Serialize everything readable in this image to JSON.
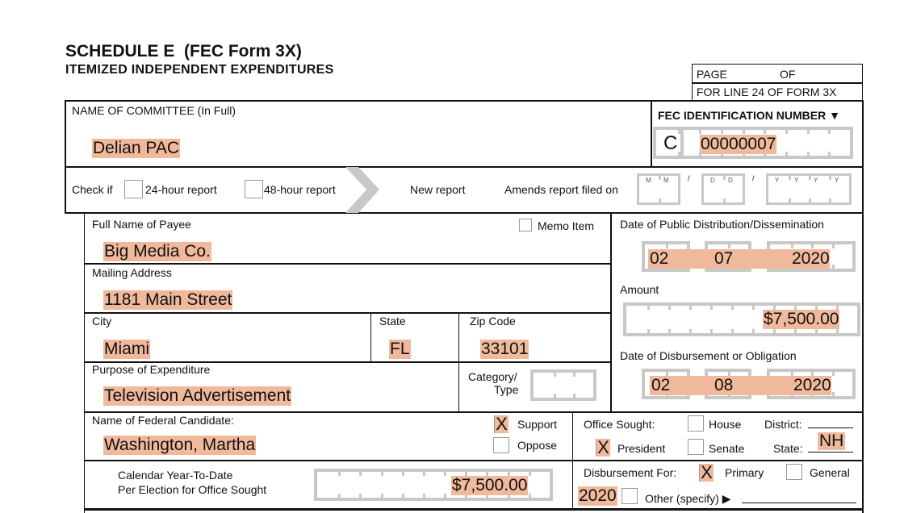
{
  "header": {
    "title": "SCHEDULE E  (FEC Form 3X)",
    "subtitle": "ITEMIZED INDEPENDENT EXPENDITURES",
    "page_label": "PAGE",
    "of_label": "OF",
    "line_ref": "FOR LINE 24 OF FORM 3X"
  },
  "committee": {
    "name_label": "NAME OF COMMITTEE (In Full)",
    "name_value": "Delian PAC",
    "fec_id_label": "FEC IDENTIFICATION NUMBER ▼",
    "fec_id_prefix": "C",
    "fec_id_value": "00000007"
  },
  "report_type": {
    "check_if_label": "Check if",
    "option_24h": "24-hour report",
    "option_48h": "48-hour report",
    "new_report": "New report",
    "amends_label": "Amends report filed on",
    "date_placeholders": {
      "m": "M",
      "d": "D",
      "y": "Y"
    },
    "sep": "/"
  },
  "payee": {
    "name_label": "Full Name of Payee",
    "name_value": "Big Media Co.",
    "memo_label": "Memo Item",
    "address_label": "Mailing Address",
    "address_value": "1181 Main Street",
    "city_label": "City",
    "city_value": "Miami",
    "state_label": "State",
    "state_value": "FL",
    "zip_label": "Zip Code",
    "zip_value": "33101",
    "purpose_label": "Purpose of Expenditure",
    "purpose_value": "Television Advertisement",
    "category_label_1": "Category/",
    "category_label_2": "Type"
  },
  "dissemination": {
    "label": "Date of Public Distribution/Dissemination",
    "month": "02",
    "day": "07",
    "year": "2020"
  },
  "amount": {
    "label": "Amount",
    "value": "$7,500.00"
  },
  "disbursement_date": {
    "label": "Date of Disbursement or Obligation",
    "month": "02",
    "day": "08",
    "year": "2020"
  },
  "candidate": {
    "name_label": "Name of Federal Candidate:",
    "name_value": "Washington, Martha",
    "support_label": "Support",
    "support_checked": "X",
    "oppose_label": "Oppose",
    "ytd_label_1": "Calendar Year-To-Date",
    "ytd_label_2": "Per Election for Office Sought",
    "ytd_value": "$7,500.00"
  },
  "office": {
    "label": "Office Sought:",
    "house": "House",
    "president": "President",
    "president_checked": "X",
    "senate": "Senate",
    "district_label": "District:",
    "state_label": "State:",
    "state_value": "NH"
  },
  "disbursement_for": {
    "label": "Disbursement For:",
    "primary": "Primary",
    "primary_checked": "X",
    "general": "General",
    "year_value": "2020",
    "other": "Other (specify) ▶"
  }
}
